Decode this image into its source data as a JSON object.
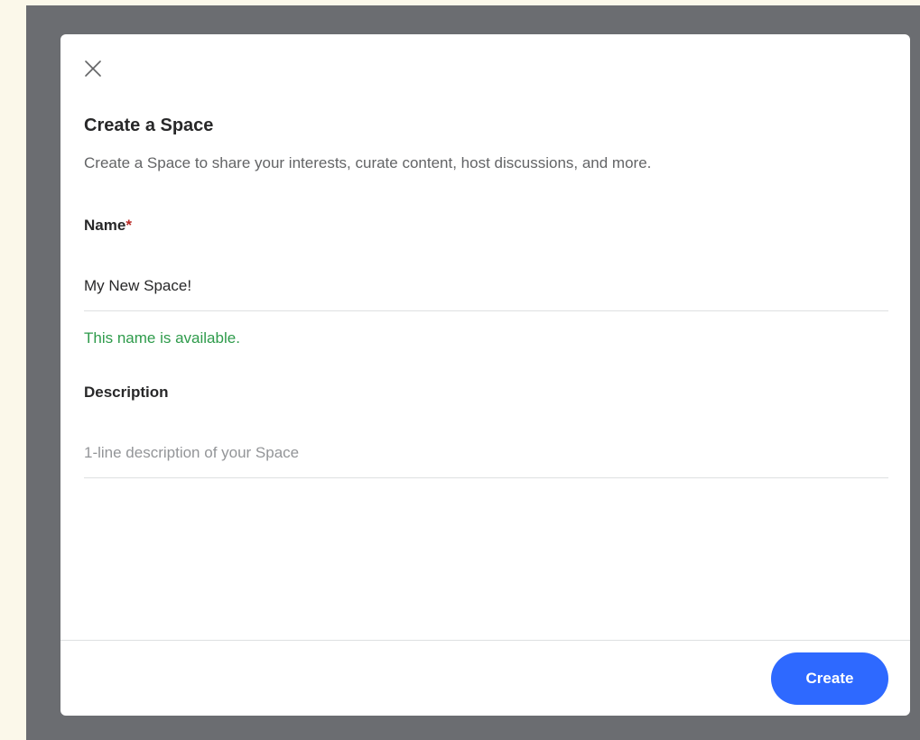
{
  "modal": {
    "title": "Create a Space",
    "subtitle": "Create a Space to share your interests, curate content, host discussions, and more.",
    "close_icon": "close-icon"
  },
  "name_field": {
    "label": "Name",
    "required_marker": "*",
    "value": "My New Space!",
    "status": "This name is available.",
    "status_color": "#2e9b4b"
  },
  "description_field": {
    "label": "Description",
    "value": "",
    "placeholder": "1-line description of your Space"
  },
  "footer": {
    "create_label": "Create"
  },
  "colors": {
    "accent": "#2e69ff",
    "required": "#b92b27",
    "overlay": "#6b6d71"
  }
}
